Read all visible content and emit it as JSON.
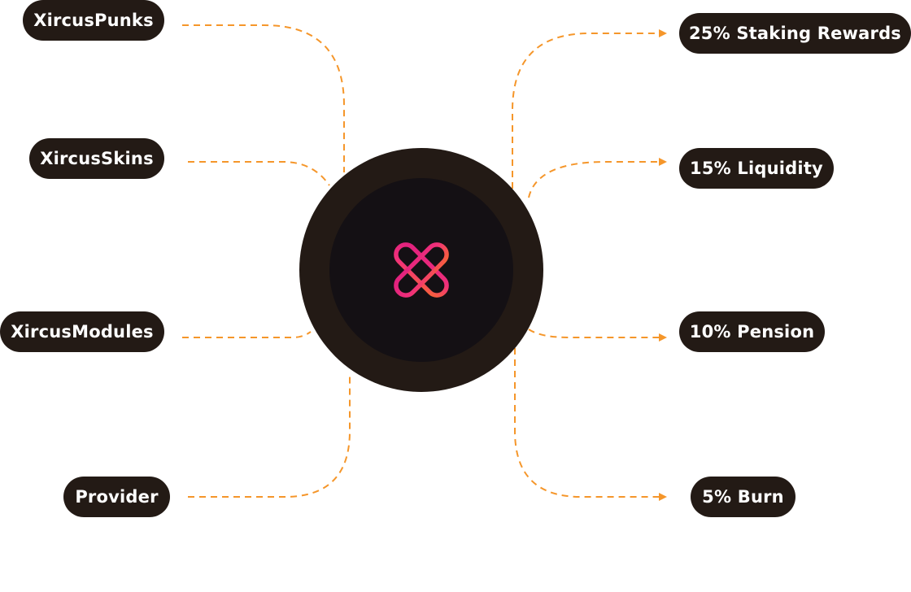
{
  "inputs": [
    {
      "id": "xircus-punks",
      "label": "XircusPunks"
    },
    {
      "id": "xircus-skins",
      "label": "XircusSkins"
    },
    {
      "id": "xircus-modules",
      "label": "XircusModules"
    },
    {
      "id": "provider",
      "label": "Provider"
    }
  ],
  "outputs": [
    {
      "id": "staking-rewards",
      "label": "25% Staking Rewards"
    },
    {
      "id": "liquidity",
      "label": "15% Liquidity"
    },
    {
      "id": "pension",
      "label": "10% Pension"
    },
    {
      "id": "burn",
      "label": "5% Burn"
    }
  ],
  "hub": {
    "icon": "xircus-logo-icon"
  },
  "colors": {
    "pill_background": "#231a15",
    "pill_text": "#ffffff",
    "connector": "#f5962a",
    "hub_outer": "#231a15",
    "hub_inner": "#141014",
    "logo_gradient_start": "#e0207e",
    "logo_gradient_mid": "#f0307a",
    "logo_gradient_end": "#f7623a"
  }
}
